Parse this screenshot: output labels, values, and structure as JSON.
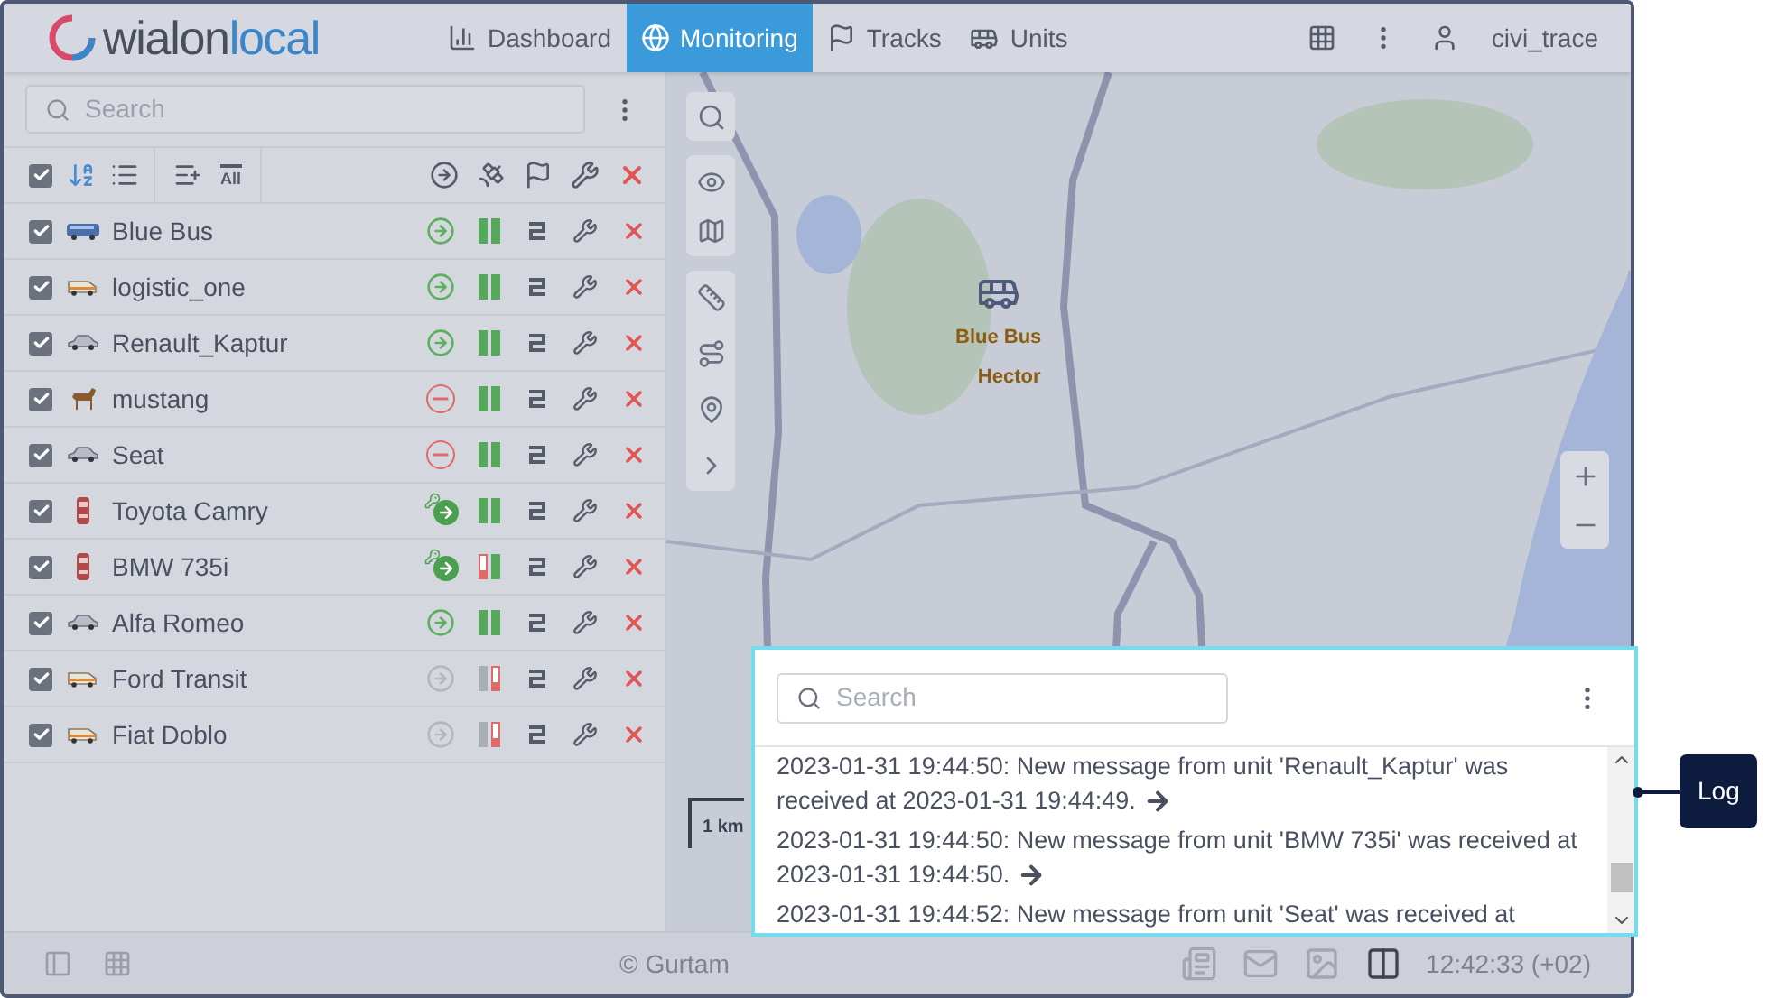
{
  "logo": {
    "part1": "wialon",
    "part2": "local"
  },
  "nav": [
    {
      "label": "Dashboard",
      "kind": "chart",
      "selected": false
    },
    {
      "label": "Monitoring",
      "kind": "globe",
      "selected": true
    },
    {
      "label": "Tracks",
      "kind": "flag",
      "selected": false
    },
    {
      "label": "Units",
      "kind": "bus",
      "selected": false
    }
  ],
  "user": {
    "name": "civi_trace"
  },
  "search": {
    "placeholder": "Search"
  },
  "toolbar": {
    "all_label": "All",
    "select_all_checked": true
  },
  "units": [
    {
      "name": "Blue Bus",
      "kind": "bus",
      "checked": true,
      "status": {
        "kind": "online"
      },
      "bars": [
        {
          "kind": "ok"
        },
        {
          "kind": "ok"
        }
      ]
    },
    {
      "name": "logistic_one",
      "kind": "van",
      "checked": true,
      "status": {
        "kind": "online"
      },
      "bars": [
        {
          "kind": "ok"
        },
        {
          "kind": "ok"
        }
      ]
    },
    {
      "name": "Renault_Kaptur",
      "kind": "car",
      "checked": true,
      "status": {
        "kind": "online"
      },
      "bars": [
        {
          "kind": "ok"
        },
        {
          "kind": "ok"
        }
      ]
    },
    {
      "name": "mustang",
      "kind": "horse",
      "checked": true,
      "status": {
        "kind": "offline"
      },
      "bars": [
        {
          "kind": "ok"
        },
        {
          "kind": "ok"
        }
      ]
    },
    {
      "name": "Seat",
      "kind": "car",
      "checked": true,
      "status": {
        "kind": "offline"
      },
      "bars": [
        {
          "kind": "ok"
        },
        {
          "kind": "ok"
        }
      ]
    },
    {
      "name": "Toyota Camry",
      "kind": "car-top",
      "checked": true,
      "status": {
        "kind": "moving"
      },
      "bars": [
        {
          "kind": "ok"
        },
        {
          "kind": "ok"
        }
      ]
    },
    {
      "name": "BMW 735i",
      "kind": "car-top",
      "checked": true,
      "status": {
        "kind": "moving"
      },
      "bars": [
        {
          "kind": "low"
        },
        {
          "kind": "ok"
        }
      ]
    },
    {
      "name": "Alfa Romeo",
      "kind": "car",
      "checked": true,
      "status": {
        "kind": "online"
      },
      "bars": [
        {
          "kind": "ok"
        },
        {
          "kind": "ok"
        }
      ]
    },
    {
      "name": "Ford Transit",
      "kind": "van",
      "checked": true,
      "status": {
        "kind": "unknown"
      },
      "bars": [
        {
          "kind": "none"
        },
        {
          "kind": "low"
        }
      ]
    },
    {
      "name": "Fiat Doblo",
      "kind": "van",
      "checked": true,
      "status": {
        "kind": "unknown"
      },
      "bars": [
        {
          "kind": "none"
        },
        {
          "kind": "low"
        }
      ]
    }
  ],
  "map": {
    "markers": [
      "Blue Bus",
      "Hector"
    ],
    "scale": "1 km"
  },
  "log": {
    "search_placeholder": "Search",
    "entries": [
      {
        "text": "2023-01-31 19:44:50: New message from unit 'Renault_Kaptur' was received at 2023-01-31 19:44:49.",
        "arrow": true
      },
      {
        "text": "2023-01-31 19:44:50: New message from unit 'BMW 735i' was received at 2023-01-31 19:44:50.",
        "arrow": true
      },
      {
        "text": "2023-01-31 19:44:52: New message from unit 'Seat' was received at",
        "arrow": false
      }
    ]
  },
  "footer": {
    "copyright": "© Gurtam",
    "time": "12:42:33 (+02)"
  },
  "callout": {
    "label": "Log"
  }
}
